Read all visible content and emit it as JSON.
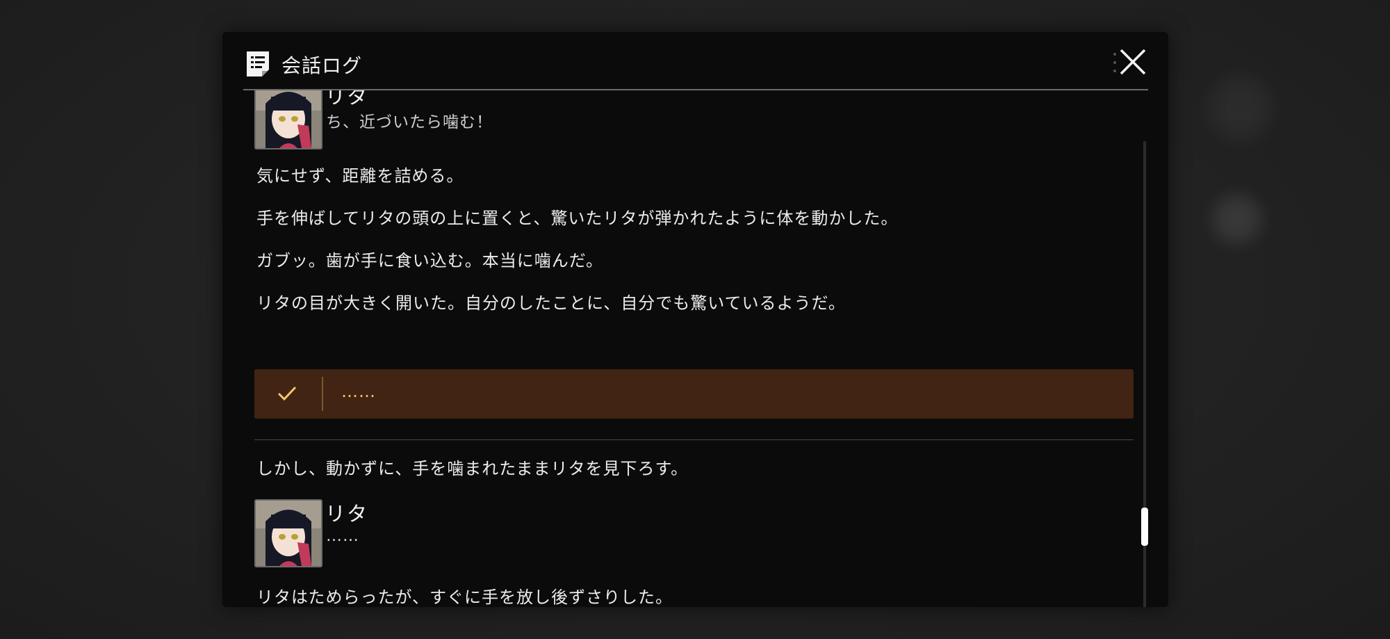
{
  "window": {
    "title": "会話ログ"
  },
  "entries": {
    "dialogue_1": {
      "speaker": "リタ",
      "text": "ち、近づいたら噛む！"
    },
    "narration_1": "気にせず、距離を詰める。",
    "narration_2": "手を伸ばしてリタの頭の上に置くと、驚いたリタが弾かれたように体を動かした。",
    "narration_3": "ガブッ。歯が手に食い込む。本当に噛んだ。",
    "narration_4": "リタの目が大きく開いた。自分のしたことに、自分でも驚いているようだ。",
    "choice": {
      "text": "……"
    },
    "narration_5": "しかし、動かずに、手を噛まれたままリタを見下ろす。",
    "dialogue_2": {
      "speaker": "リタ",
      "text": "……"
    },
    "narration_6": "リタはためらったが、すぐに手を放し後ずさりした。"
  },
  "icons": {
    "header": "log-icon",
    "close": "close-icon",
    "choice": "checkmark-icon"
  },
  "colors": {
    "window_bg": "#0b0b0b",
    "choice_bg": "#412414",
    "choice_text": "#f4c66a",
    "accent_hair": "#c23a5a"
  }
}
